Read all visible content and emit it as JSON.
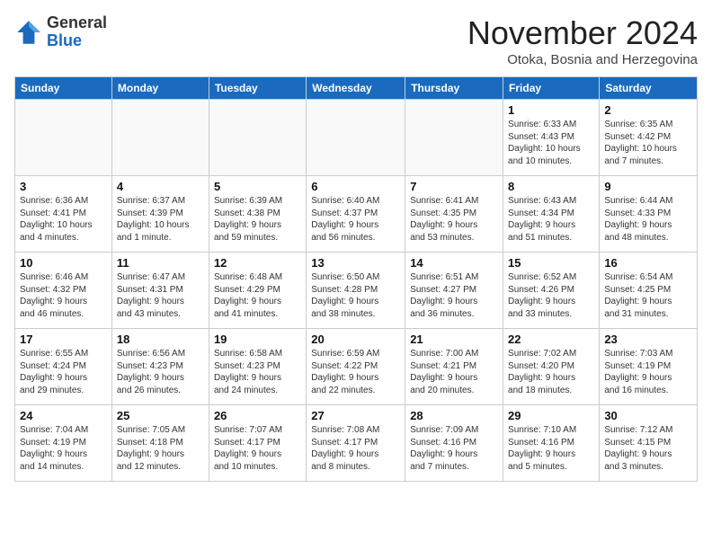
{
  "header": {
    "logo_general": "General",
    "logo_blue": "Blue",
    "month_title": "November 2024",
    "subtitle": "Otoka, Bosnia and Herzegovina"
  },
  "weekdays": [
    "Sunday",
    "Monday",
    "Tuesday",
    "Wednesday",
    "Thursday",
    "Friday",
    "Saturday"
  ],
  "weeks": [
    [
      {
        "day": "",
        "info": ""
      },
      {
        "day": "",
        "info": ""
      },
      {
        "day": "",
        "info": ""
      },
      {
        "day": "",
        "info": ""
      },
      {
        "day": "",
        "info": ""
      },
      {
        "day": "1",
        "info": "Sunrise: 6:33 AM\nSunset: 4:43 PM\nDaylight: 10 hours\nand 10 minutes."
      },
      {
        "day": "2",
        "info": "Sunrise: 6:35 AM\nSunset: 4:42 PM\nDaylight: 10 hours\nand 7 minutes."
      }
    ],
    [
      {
        "day": "3",
        "info": "Sunrise: 6:36 AM\nSunset: 4:41 PM\nDaylight: 10 hours\nand 4 minutes."
      },
      {
        "day": "4",
        "info": "Sunrise: 6:37 AM\nSunset: 4:39 PM\nDaylight: 10 hours\nand 1 minute."
      },
      {
        "day": "5",
        "info": "Sunrise: 6:39 AM\nSunset: 4:38 PM\nDaylight: 9 hours\nand 59 minutes."
      },
      {
        "day": "6",
        "info": "Sunrise: 6:40 AM\nSunset: 4:37 PM\nDaylight: 9 hours\nand 56 minutes."
      },
      {
        "day": "7",
        "info": "Sunrise: 6:41 AM\nSunset: 4:35 PM\nDaylight: 9 hours\nand 53 minutes."
      },
      {
        "day": "8",
        "info": "Sunrise: 6:43 AM\nSunset: 4:34 PM\nDaylight: 9 hours\nand 51 minutes."
      },
      {
        "day": "9",
        "info": "Sunrise: 6:44 AM\nSunset: 4:33 PM\nDaylight: 9 hours\nand 48 minutes."
      }
    ],
    [
      {
        "day": "10",
        "info": "Sunrise: 6:46 AM\nSunset: 4:32 PM\nDaylight: 9 hours\nand 46 minutes."
      },
      {
        "day": "11",
        "info": "Sunrise: 6:47 AM\nSunset: 4:31 PM\nDaylight: 9 hours\nand 43 minutes."
      },
      {
        "day": "12",
        "info": "Sunrise: 6:48 AM\nSunset: 4:29 PM\nDaylight: 9 hours\nand 41 minutes."
      },
      {
        "day": "13",
        "info": "Sunrise: 6:50 AM\nSunset: 4:28 PM\nDaylight: 9 hours\nand 38 minutes."
      },
      {
        "day": "14",
        "info": "Sunrise: 6:51 AM\nSunset: 4:27 PM\nDaylight: 9 hours\nand 36 minutes."
      },
      {
        "day": "15",
        "info": "Sunrise: 6:52 AM\nSunset: 4:26 PM\nDaylight: 9 hours\nand 33 minutes."
      },
      {
        "day": "16",
        "info": "Sunrise: 6:54 AM\nSunset: 4:25 PM\nDaylight: 9 hours\nand 31 minutes."
      }
    ],
    [
      {
        "day": "17",
        "info": "Sunrise: 6:55 AM\nSunset: 4:24 PM\nDaylight: 9 hours\nand 29 minutes."
      },
      {
        "day": "18",
        "info": "Sunrise: 6:56 AM\nSunset: 4:23 PM\nDaylight: 9 hours\nand 26 minutes."
      },
      {
        "day": "19",
        "info": "Sunrise: 6:58 AM\nSunset: 4:23 PM\nDaylight: 9 hours\nand 24 minutes."
      },
      {
        "day": "20",
        "info": "Sunrise: 6:59 AM\nSunset: 4:22 PM\nDaylight: 9 hours\nand 22 minutes."
      },
      {
        "day": "21",
        "info": "Sunrise: 7:00 AM\nSunset: 4:21 PM\nDaylight: 9 hours\nand 20 minutes."
      },
      {
        "day": "22",
        "info": "Sunrise: 7:02 AM\nSunset: 4:20 PM\nDaylight: 9 hours\nand 18 minutes."
      },
      {
        "day": "23",
        "info": "Sunrise: 7:03 AM\nSunset: 4:19 PM\nDaylight: 9 hours\nand 16 minutes."
      }
    ],
    [
      {
        "day": "24",
        "info": "Sunrise: 7:04 AM\nSunset: 4:19 PM\nDaylight: 9 hours\nand 14 minutes."
      },
      {
        "day": "25",
        "info": "Sunrise: 7:05 AM\nSunset: 4:18 PM\nDaylight: 9 hours\nand 12 minutes."
      },
      {
        "day": "26",
        "info": "Sunrise: 7:07 AM\nSunset: 4:17 PM\nDaylight: 9 hours\nand 10 minutes."
      },
      {
        "day": "27",
        "info": "Sunrise: 7:08 AM\nSunset: 4:17 PM\nDaylight: 9 hours\nand 8 minutes."
      },
      {
        "day": "28",
        "info": "Sunrise: 7:09 AM\nSunset: 4:16 PM\nDaylight: 9 hours\nand 7 minutes."
      },
      {
        "day": "29",
        "info": "Sunrise: 7:10 AM\nSunset: 4:16 PM\nDaylight: 9 hours\nand 5 minutes."
      },
      {
        "day": "30",
        "info": "Sunrise: 7:12 AM\nSunset: 4:15 PM\nDaylight: 9 hours\nand 3 minutes."
      }
    ]
  ]
}
